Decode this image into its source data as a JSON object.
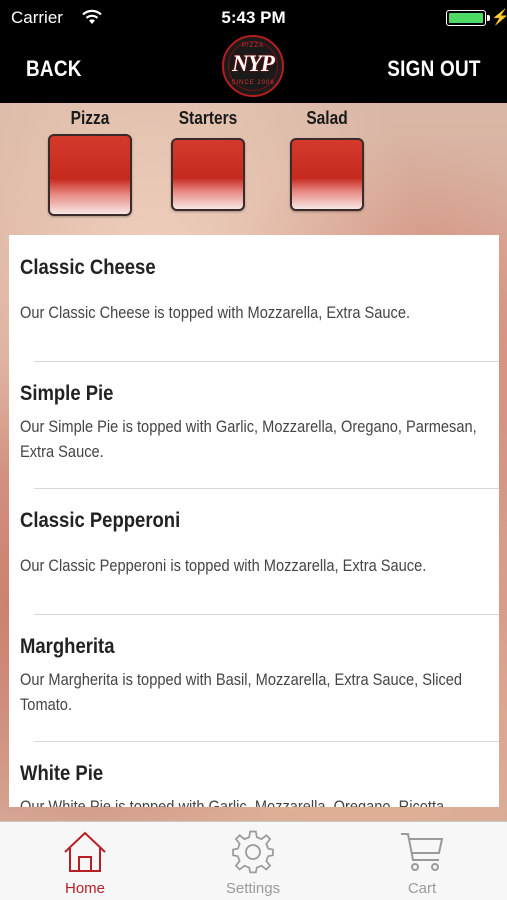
{
  "status_bar": {
    "carrier": "Carrier",
    "time": "5:43 PM",
    "battery_level": 1.0,
    "charging": true
  },
  "nav": {
    "back_label": "BACK",
    "sign_out_label": "SIGN OUT",
    "logo": {
      "text": "NYP",
      "top_text": "PIZZA",
      "bottom_text": "SINCE 2006"
    }
  },
  "categories": [
    {
      "label": "Pizza",
      "selected": true
    },
    {
      "label": "Starters",
      "selected": false
    },
    {
      "label": "Salad",
      "selected": false
    }
  ],
  "menu_items": [
    {
      "title": "Classic Cheese",
      "description": "Our Classic Cheese is topped with Mozzarella, Extra Sauce."
    },
    {
      "title": "Simple Pie",
      "description": "Our Simple Pie is topped with Garlic, Mozzarella, Oregano, Parmesan, Extra Sauce."
    },
    {
      "title": "Classic Pepperoni",
      "description": "Our Classic Pepperoni is topped with Mozzarella, Extra Sauce."
    },
    {
      "title": "Margherita",
      "description": "Our Margherita is topped with Basil, Mozzarella, Extra Sauce, Sliced Tomato."
    },
    {
      "title": "White Pie",
      "description": "Our White Pie is topped with Garlic, Mozzarella, Oregano, Ricotta."
    }
  ],
  "tabs": [
    {
      "label": "Home",
      "icon": "home-icon",
      "active": true
    },
    {
      "label": "Settings",
      "icon": "gear-icon",
      "active": false
    },
    {
      "label": "Cart",
      "icon": "cart-icon",
      "active": false
    }
  ],
  "colors": {
    "accent": "#b81f24",
    "tab_inactive": "#9a9a9a",
    "tile_red": "#c62a1f",
    "battery": "#4cd964"
  }
}
